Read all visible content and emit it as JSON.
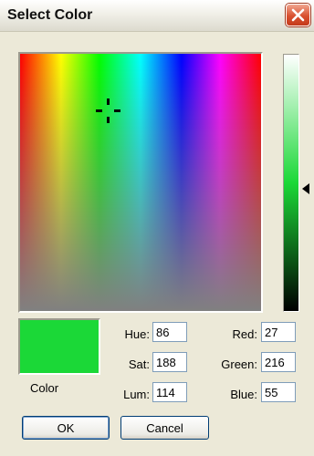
{
  "window": {
    "title": "Select Color",
    "close_icon": "close-icon"
  },
  "color_label": "Color",
  "selected_color": "#1bd837",
  "fields": {
    "hue": {
      "label": "Hue:",
      "value": "86"
    },
    "sat": {
      "label": "Sat:",
      "value": "188"
    },
    "lum": {
      "label": "Lum:",
      "value": "114"
    },
    "red": {
      "label": "Red:",
      "value": "27"
    },
    "green": {
      "label": "Green:",
      "value": "216"
    },
    "blue": {
      "label": "Blue:",
      "value": "55"
    }
  },
  "buttons": {
    "ok": "OK",
    "cancel": "Cancel"
  }
}
